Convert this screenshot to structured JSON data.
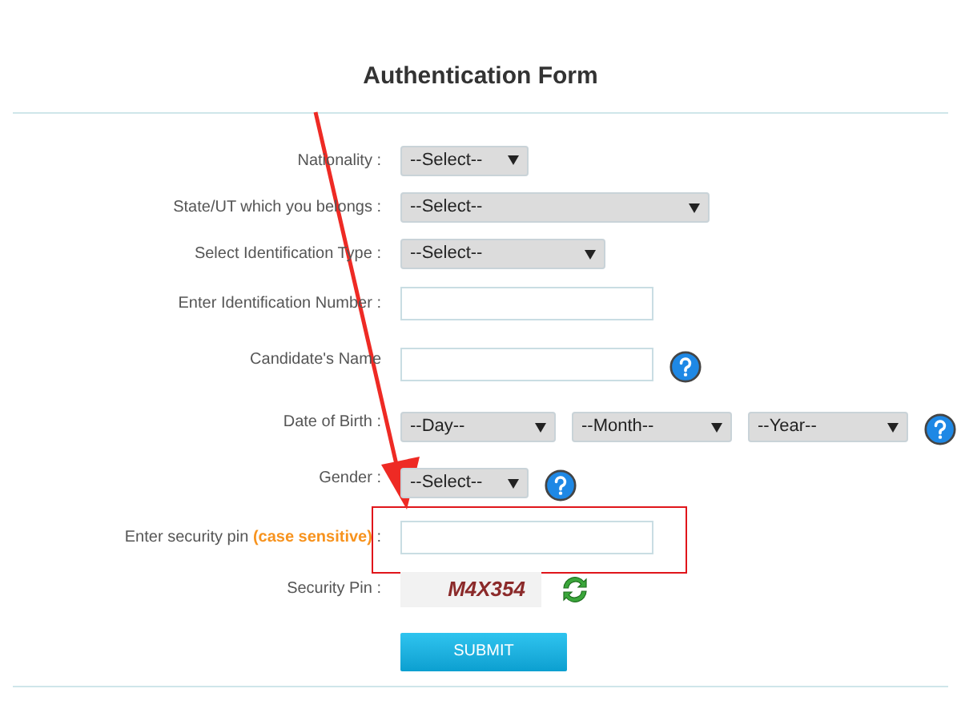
{
  "title": "Authentication Form",
  "rows": [
    {
      "kind": "select",
      "label": "Nationality :",
      "help": false,
      "selects": [
        "--Select--"
      ]
    },
    {
      "kind": "select",
      "label": "State/UT which you belongs :",
      "help": false,
      "selects": [
        "--Select--"
      ]
    },
    {
      "kind": "select",
      "label": "Select Identification Type :",
      "help": false,
      "selects": [
        "--Select--"
      ]
    },
    {
      "kind": "input",
      "label": "Enter Identification Number :",
      "help": false
    },
    {
      "kind": "input",
      "label": "Candidate's Name",
      "help": true
    },
    {
      "kind": "select",
      "label": "Date of Birth :",
      "help": true,
      "selects": [
        "--Day--",
        "--Month--",
        "--Year--"
      ]
    },
    {
      "kind": "select",
      "label": "Gender :",
      "help": true,
      "selects": [
        "--Select--"
      ]
    },
    {
      "kind": "pin",
      "label": "Enter security pin",
      "note": "(case sensitive)",
      "label_end": ":",
      "help": false
    },
    {
      "kind": "captcha",
      "label": "Security Pin :",
      "code": "M4X354",
      "help": false
    }
  ],
  "submit": "SUBMIT"
}
